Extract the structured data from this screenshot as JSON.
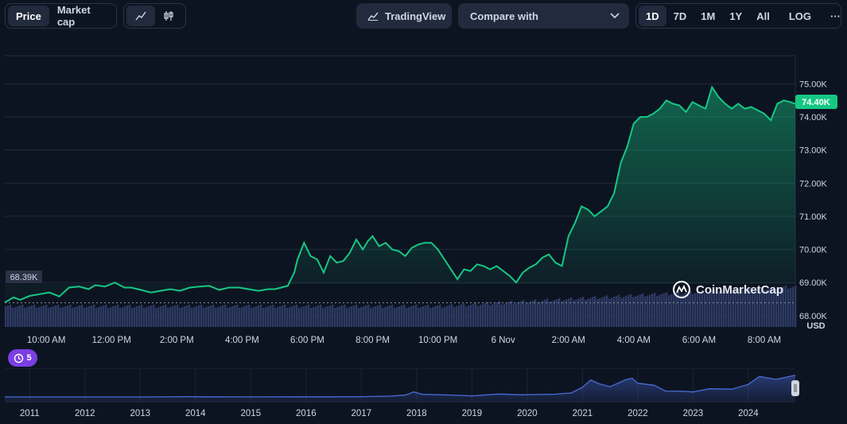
{
  "toolbar": {
    "price_label": "Price",
    "market_cap_label": "Market cap",
    "tradingview_label": "TradingView",
    "compare_label": "Compare with",
    "ranges": [
      "1D",
      "7D",
      "1M",
      "1Y",
      "All"
    ],
    "active_range": "1D",
    "log_label": "LOG",
    "more_label": "···"
  },
  "colors": {
    "line": "#16c784",
    "background": "#0d1421",
    "volume": "#2d3a63",
    "overview": "#4a6bd8",
    "badge": "#7b3fe4"
  },
  "chart_data": [
    {
      "type": "area",
      "y_unit": "USD",
      "ylim": [
        67660,
        75850
      ],
      "y_ticks": [
        68000,
        69000,
        70000,
        71000,
        72000,
        73000,
        74000,
        75000
      ],
      "y_tick_labels": [
        "68.00K",
        "69.00K",
        "70.00K",
        "71.00K",
        "72.00K",
        "73.00K",
        "74.00K",
        "75.00K"
      ],
      "x_ticks": [
        "10:00 AM",
        "12:00 PM",
        "2:00 PM",
        "4:00 PM",
        "6:00 PM",
        "8:00 PM",
        "10:00 PM",
        "6 Nov",
        "2:00 AM",
        "4:00 AM",
        "6:00 AM",
        "8:00 AM"
      ],
      "x_tick_hours": [
        10,
        12,
        14,
        16,
        18,
        20,
        22,
        24,
        26,
        28,
        30,
        32
      ],
      "xlim_hours": [
        8.73,
        32.95
      ],
      "open_price": 68390,
      "open_label": "68.39K",
      "current_price": 74400,
      "current_label": "74.40K",
      "watermark": "CoinMarketCap",
      "grid": true,
      "series": [
        {
          "x_hours": [
            8.73,
            9.0,
            9.2,
            9.5,
            9.8,
            10.1,
            10.4,
            10.7,
            11.0,
            11.3,
            11.5,
            11.8,
            12.1,
            12.4,
            12.6,
            12.9,
            13.2,
            13.5,
            13.8,
            14.1,
            14.4,
            14.7,
            15.0,
            15.3,
            15.6,
            15.9,
            16.2,
            16.5,
            16.8,
            17.0,
            17.2,
            17.4,
            17.6,
            17.7,
            17.9,
            18.1,
            18.3,
            18.5,
            18.7,
            18.9,
            19.1,
            19.3,
            19.5,
            19.7,
            19.85,
            20.0,
            20.2,
            20.4,
            20.6,
            20.8,
            21.0,
            21.2,
            21.4,
            21.6,
            21.8,
            22.0,
            22.2,
            22.4,
            22.6,
            22.8,
            23.0,
            23.2,
            23.4,
            23.6,
            23.8,
            24.0,
            24.2,
            24.4,
            24.6,
            24.8,
            25.0,
            25.2,
            25.4,
            25.6,
            25.8,
            26.0,
            26.2,
            26.4,
            26.6,
            26.8,
            27.0,
            27.2,
            27.4,
            27.6,
            27.8,
            28.0,
            28.2,
            28.4,
            28.6,
            28.8,
            29.0,
            29.2,
            29.4,
            29.6,
            29.8,
            30.0,
            30.2,
            30.4,
            30.6,
            30.8,
            31.0,
            31.2,
            31.4,
            31.6,
            31.8,
            32.0,
            32.2,
            32.4,
            32.6,
            32.8,
            32.95
          ],
          "values": [
            68400,
            68550,
            68480,
            68600,
            68650,
            68700,
            68580,
            68850,
            68880,
            68800,
            68920,
            68880,
            69000,
            68850,
            68850,
            68780,
            68700,
            68750,
            68800,
            68750,
            68850,
            68880,
            68900,
            68780,
            68850,
            68850,
            68800,
            68750,
            68800,
            68800,
            68850,
            68900,
            69300,
            69700,
            70200,
            69800,
            69700,
            69300,
            69800,
            69600,
            69650,
            69900,
            70300,
            70000,
            70250,
            70400,
            70100,
            70200,
            70000,
            69950,
            69800,
            70050,
            70150,
            70200,
            70200,
            70000,
            69700,
            69400,
            69100,
            69400,
            69350,
            69550,
            69500,
            69400,
            69500,
            69350,
            69200,
            69000,
            69300,
            69450,
            69550,
            69750,
            69850,
            69600,
            69500,
            70400,
            70800,
            71300,
            71200,
            71000,
            71150,
            71300,
            71700,
            72600,
            73100,
            73800,
            74000,
            74000,
            74100,
            74250,
            74500,
            74400,
            74350,
            74150,
            74450,
            74350,
            74250,
            74900,
            74600,
            74400,
            74250,
            74400,
            74250,
            74300,
            74200,
            74100,
            73900,
            74400,
            74500,
            74450,
            74400
          ]
        }
      ]
    },
    {
      "type": "area",
      "x_ticks": [
        "2011",
        "2012",
        "2013",
        "2014",
        "2015",
        "2016",
        "2017",
        "2018",
        "2019",
        "2020",
        "2021",
        "2022",
        "2023",
        "2024"
      ],
      "xlim_years": [
        2010.55,
        2024.85
      ],
      "series": [
        {
          "x_years": [
            2010.55,
            2011.0,
            2012.0,
            2013.0,
            2013.9,
            2014.1,
            2015.0,
            2016.0,
            2016.5,
            2017.0,
            2017.5,
            2017.8,
            2017.95,
            2018.1,
            2018.5,
            2019.0,
            2019.5,
            2019.9,
            2020.0,
            2020.5,
            2020.8,
            2021.0,
            2021.15,
            2021.3,
            2021.5,
            2021.8,
            2021.9,
            2022.0,
            2022.3,
            2022.5,
            2022.8,
            2023.0,
            2023.3,
            2023.7,
            2024.0,
            2024.2,
            2024.5,
            2024.85
          ],
          "values": [
            0,
            0,
            5,
            100,
            1000,
            600,
            300,
            430,
            650,
            1000,
            2700,
            6500,
            17000,
            9000,
            7000,
            3700,
            10000,
            7200,
            8000,
            9500,
            13500,
            33000,
            58000,
            45000,
            35000,
            60000,
            64000,
            47000,
            40000,
            20000,
            19500,
            17000,
            28000,
            26500,
            43000,
            70000,
            60000,
            74400
          ]
        }
      ]
    }
  ],
  "volume_label": "USD",
  "history_badge": {
    "count": "5"
  }
}
